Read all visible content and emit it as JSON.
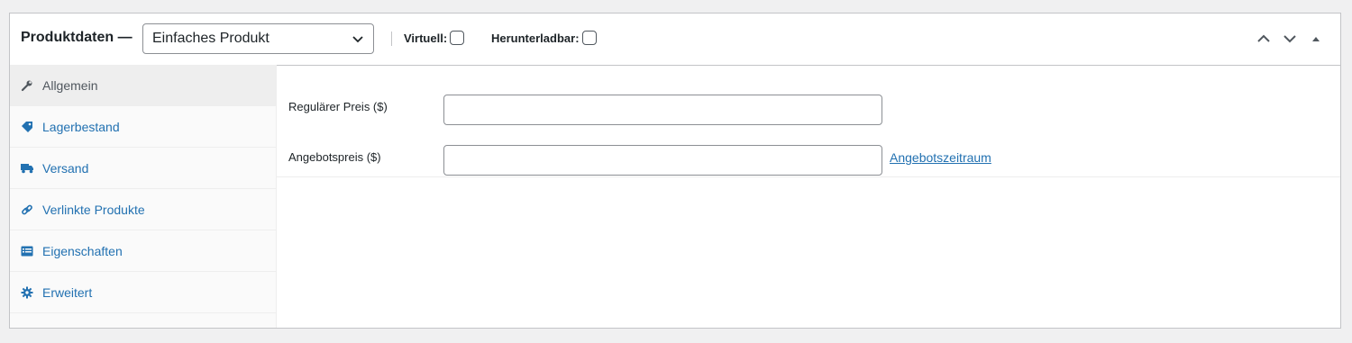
{
  "header": {
    "title": "Produktdaten —",
    "product_type": "Einfaches Produkt",
    "virtual_label": "Virtuell:",
    "downloadable_label": "Herunterladbar:"
  },
  "tabs": [
    {
      "label": "Allgemein",
      "icon": "wrench-icon"
    },
    {
      "label": "Lagerbestand",
      "icon": "tag-icon"
    },
    {
      "label": "Versand",
      "icon": "truck-icon"
    },
    {
      "label": "Verlinkte Produkte",
      "icon": "link-icon"
    },
    {
      "label": "Eigenschaften",
      "icon": "list-icon"
    },
    {
      "label": "Erweitert",
      "icon": "gear-icon"
    }
  ],
  "general": {
    "regular_price_label": "Regulärer Preis ($)",
    "regular_price_value": "",
    "sale_price_label": "Angebotspreis ($)",
    "sale_price_value": "",
    "sale_schedule_link": "Angebotszeitraum"
  },
  "colors": {
    "link": "#2271b1",
    "border": "#c3c4c7",
    "active_tab_bg": "#eeeeee"
  }
}
